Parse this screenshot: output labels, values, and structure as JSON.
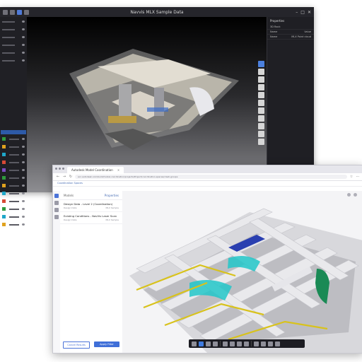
{
  "viewer_a": {
    "window_title": "Navvis MLX Sample Data",
    "window_controls": [
      "–",
      "□",
      "✕"
    ],
    "right_panel": {
      "heading": "Properties",
      "subheading": "3D Rack",
      "columns": [
        "Name",
        "Value"
      ],
      "rows": [
        {
          "name": "Name",
          "value": "MLX Point cloud"
        }
      ]
    },
    "legend_colors": [
      "#2f9b3d",
      "#e0a21e",
      "#1fa7c9",
      "#d84a35",
      "#7e4bc2",
      "#2f9b3d",
      "#e0a21e",
      "#1fa7c9",
      "#d84a35",
      "#2f9b3d",
      "#1fa7c9",
      "#e0a21e"
    ],
    "tool_icons": [
      "select-icon",
      "measure-icon",
      "section-icon",
      "cube-icon",
      "home-icon",
      "clip-icon",
      "layers-icon",
      "camera-icon",
      "settings-icon",
      "fullscreen-icon",
      "grid-icon"
    ]
  },
  "viewer_b": {
    "tab_title": "Autodesk Model Coordination",
    "url": "acc.autodesk.com/build/model-coordination/projects/Project/coordination-spaces/clash-groups",
    "breadcrumb": "Coordination Spaces",
    "panel": {
      "title": "Models",
      "filter_label": "Properties",
      "items": [
        {
          "title": "Design Data - Level 2 (Coordination)",
          "meta": "Design Data",
          "author": "MLX Sample"
        },
        {
          "title": "Existing Conditions - NavVis Laser Scan",
          "meta": "Design Data",
          "author": "MLX Sample"
        }
      ],
      "cancel_label": "Cancel Results",
      "confirm_label": "Apply Filter"
    },
    "toolbar_icons": [
      "orbit-icon",
      "pan-icon",
      "fit-icon",
      "camera-icon",
      "measure-icon",
      "section-icon",
      "explode-icon",
      "model-browser-icon",
      "properties-icon",
      "settings-icon",
      "fullscreen-icon",
      "view-icon"
    ]
  }
}
